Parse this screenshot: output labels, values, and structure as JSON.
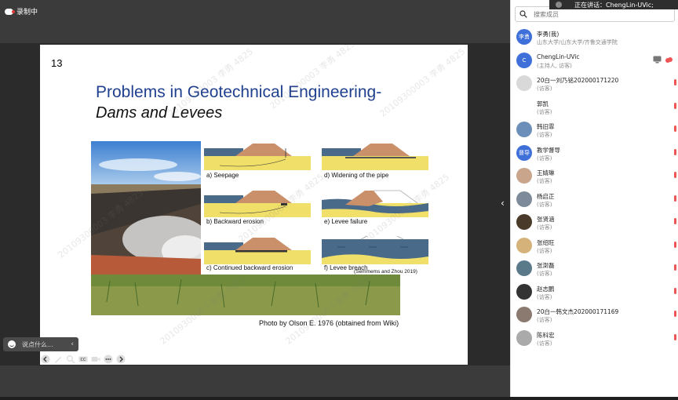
{
  "topbar": {
    "recording_label": "录制中"
  },
  "speaking": {
    "label": "正在讲话：ChengLin-UVic;"
  },
  "slide": {
    "number": "13",
    "title_line1": "Problems in Geotechnical Engineering-",
    "title_line2": "Dams and Levees",
    "photo_caption": "Photo by Olson E. 1976 (obtained from Wiki)",
    "diagrams": [
      {
        "label": "a) Seepage"
      },
      {
        "label": "d) Widening of the pipe"
      },
      {
        "label": "b) Backward erosion"
      },
      {
        "label": "e) Levee failure"
      },
      {
        "label": "c) Continued backward erosion"
      },
      {
        "label": "f) Levee breach"
      }
    ],
    "credit": "(Semmems and Zhou 2019)",
    "watermark": "20109300003 李勇 4825"
  },
  "chat": {
    "placeholder": "说点什么..."
  },
  "panel": {
    "search_placeholder": "搜索成员",
    "members": [
      {
        "initials": "李勇",
        "name": "李勇(我)",
        "role": "山东大学/山东大学/齐鲁交通学院",
        "color": "#3f6fd8"
      },
      {
        "initials": "C",
        "name": "ChengLin-UVic",
        "role": "(主持人, 访客)",
        "color": "#3f6fd8"
      },
      {
        "initials": "",
        "name": "20白一刘乃铭202000171220",
        "role": "(访客)",
        "color": "#d9d9d9"
      },
      {
        "initials": "",
        "name": "郭凯",
        "role": "(访客)",
        "color": "#ffffff"
      },
      {
        "initials": "",
        "name": "韩旧霏",
        "role": "(访客)",
        "color": "#6b8fb8"
      },
      {
        "initials": "督导",
        "name": "教学督导",
        "role": "(访客)",
        "color": "#3f6fd8"
      },
      {
        "initials": "",
        "name": "王婧琳",
        "role": "(访客)",
        "color": "#c9a58c"
      },
      {
        "initials": "",
        "name": "杨启正",
        "role": "(访客)",
        "color": "#7d8a99"
      },
      {
        "initials": "",
        "name": "张贤涵",
        "role": "(访客)",
        "color": "#4a3a2a"
      },
      {
        "initials": "",
        "name": "张绍旺",
        "role": "(访客)",
        "color": "#d4b27a"
      },
      {
        "initials": "",
        "name": "张澍磊",
        "role": "(访客)",
        "color": "#5a7a8a"
      },
      {
        "initials": "",
        "name": "赵志鹏",
        "role": "(访客)",
        "color": "#333333"
      },
      {
        "initials": "",
        "name": "20白一韩文杰202000171169",
        "role": "(访客)",
        "color": "#8a7a70"
      },
      {
        "initials": "",
        "name": "陈科宏",
        "role": "(访客)",
        "color": "#aaaaaa"
      }
    ]
  }
}
